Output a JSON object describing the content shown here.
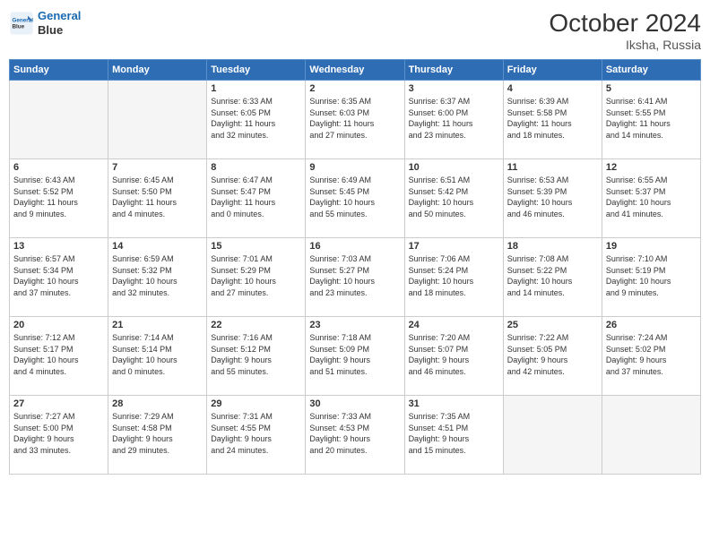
{
  "logo": {
    "line1": "General",
    "line2": "Blue"
  },
  "header": {
    "month": "October 2024",
    "location": "Iksha, Russia"
  },
  "weekdays": [
    "Sunday",
    "Monday",
    "Tuesday",
    "Wednesday",
    "Thursday",
    "Friday",
    "Saturday"
  ],
  "weeks": [
    [
      {
        "day": "",
        "info": ""
      },
      {
        "day": "",
        "info": ""
      },
      {
        "day": "1",
        "info": "Sunrise: 6:33 AM\nSunset: 6:05 PM\nDaylight: 11 hours\nand 32 minutes."
      },
      {
        "day": "2",
        "info": "Sunrise: 6:35 AM\nSunset: 6:03 PM\nDaylight: 11 hours\nand 27 minutes."
      },
      {
        "day": "3",
        "info": "Sunrise: 6:37 AM\nSunset: 6:00 PM\nDaylight: 11 hours\nand 23 minutes."
      },
      {
        "day": "4",
        "info": "Sunrise: 6:39 AM\nSunset: 5:58 PM\nDaylight: 11 hours\nand 18 minutes."
      },
      {
        "day": "5",
        "info": "Sunrise: 6:41 AM\nSunset: 5:55 PM\nDaylight: 11 hours\nand 14 minutes."
      }
    ],
    [
      {
        "day": "6",
        "info": "Sunrise: 6:43 AM\nSunset: 5:52 PM\nDaylight: 11 hours\nand 9 minutes."
      },
      {
        "day": "7",
        "info": "Sunrise: 6:45 AM\nSunset: 5:50 PM\nDaylight: 11 hours\nand 4 minutes."
      },
      {
        "day": "8",
        "info": "Sunrise: 6:47 AM\nSunset: 5:47 PM\nDaylight: 11 hours\nand 0 minutes."
      },
      {
        "day": "9",
        "info": "Sunrise: 6:49 AM\nSunset: 5:45 PM\nDaylight: 10 hours\nand 55 minutes."
      },
      {
        "day": "10",
        "info": "Sunrise: 6:51 AM\nSunset: 5:42 PM\nDaylight: 10 hours\nand 50 minutes."
      },
      {
        "day": "11",
        "info": "Sunrise: 6:53 AM\nSunset: 5:39 PM\nDaylight: 10 hours\nand 46 minutes."
      },
      {
        "day": "12",
        "info": "Sunrise: 6:55 AM\nSunset: 5:37 PM\nDaylight: 10 hours\nand 41 minutes."
      }
    ],
    [
      {
        "day": "13",
        "info": "Sunrise: 6:57 AM\nSunset: 5:34 PM\nDaylight: 10 hours\nand 37 minutes."
      },
      {
        "day": "14",
        "info": "Sunrise: 6:59 AM\nSunset: 5:32 PM\nDaylight: 10 hours\nand 32 minutes."
      },
      {
        "day": "15",
        "info": "Sunrise: 7:01 AM\nSunset: 5:29 PM\nDaylight: 10 hours\nand 27 minutes."
      },
      {
        "day": "16",
        "info": "Sunrise: 7:03 AM\nSunset: 5:27 PM\nDaylight: 10 hours\nand 23 minutes."
      },
      {
        "day": "17",
        "info": "Sunrise: 7:06 AM\nSunset: 5:24 PM\nDaylight: 10 hours\nand 18 minutes."
      },
      {
        "day": "18",
        "info": "Sunrise: 7:08 AM\nSunset: 5:22 PM\nDaylight: 10 hours\nand 14 minutes."
      },
      {
        "day": "19",
        "info": "Sunrise: 7:10 AM\nSunset: 5:19 PM\nDaylight: 10 hours\nand 9 minutes."
      }
    ],
    [
      {
        "day": "20",
        "info": "Sunrise: 7:12 AM\nSunset: 5:17 PM\nDaylight: 10 hours\nand 4 minutes."
      },
      {
        "day": "21",
        "info": "Sunrise: 7:14 AM\nSunset: 5:14 PM\nDaylight: 10 hours\nand 0 minutes."
      },
      {
        "day": "22",
        "info": "Sunrise: 7:16 AM\nSunset: 5:12 PM\nDaylight: 9 hours\nand 55 minutes."
      },
      {
        "day": "23",
        "info": "Sunrise: 7:18 AM\nSunset: 5:09 PM\nDaylight: 9 hours\nand 51 minutes."
      },
      {
        "day": "24",
        "info": "Sunrise: 7:20 AM\nSunset: 5:07 PM\nDaylight: 9 hours\nand 46 minutes."
      },
      {
        "day": "25",
        "info": "Sunrise: 7:22 AM\nSunset: 5:05 PM\nDaylight: 9 hours\nand 42 minutes."
      },
      {
        "day": "26",
        "info": "Sunrise: 7:24 AM\nSunset: 5:02 PM\nDaylight: 9 hours\nand 37 minutes."
      }
    ],
    [
      {
        "day": "27",
        "info": "Sunrise: 7:27 AM\nSunset: 5:00 PM\nDaylight: 9 hours\nand 33 minutes."
      },
      {
        "day": "28",
        "info": "Sunrise: 7:29 AM\nSunset: 4:58 PM\nDaylight: 9 hours\nand 29 minutes."
      },
      {
        "day": "29",
        "info": "Sunrise: 7:31 AM\nSunset: 4:55 PM\nDaylight: 9 hours\nand 24 minutes."
      },
      {
        "day": "30",
        "info": "Sunrise: 7:33 AM\nSunset: 4:53 PM\nDaylight: 9 hours\nand 20 minutes."
      },
      {
        "day": "31",
        "info": "Sunrise: 7:35 AM\nSunset: 4:51 PM\nDaylight: 9 hours\nand 15 minutes."
      },
      {
        "day": "",
        "info": ""
      },
      {
        "day": "",
        "info": ""
      }
    ]
  ]
}
